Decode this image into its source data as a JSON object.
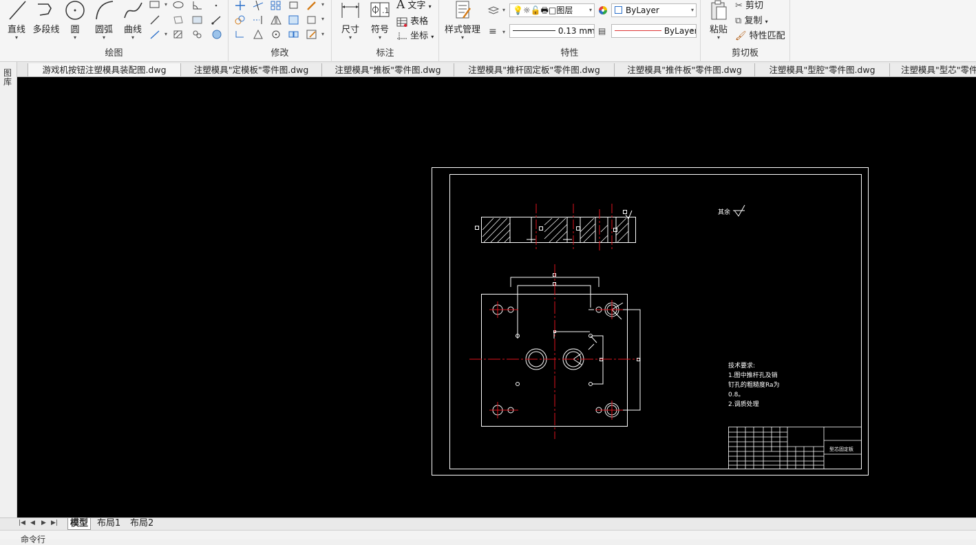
{
  "ribbon": {
    "draw": {
      "title": "绘图",
      "line": "直线",
      "polyline": "多段线",
      "circle": "圆",
      "arc": "圆弧",
      "curve": "曲线"
    },
    "modify": {
      "title": "修改"
    },
    "annotate": {
      "title": "标注",
      "dimension": "尺寸",
      "symbol": "符号",
      "text": "文字",
      "table": "表格",
      "coordinate": "坐标"
    },
    "properties": {
      "title": "特性",
      "style_manager": "样式管理",
      "layer_combo": "图层",
      "color_combo": "ByLayer",
      "lineweight_combo": "0.13 mm",
      "linetype_combo": "ByLayer"
    },
    "clipboard": {
      "title": "剪切板",
      "paste": "粘贴",
      "cut": "剪切",
      "copy": "复制",
      "match_props": "特性匹配"
    }
  },
  "file_tabs": [
    "游戏机按钮注塑模具装配图.dwg",
    "注塑模具\"定模板\"零件图.dwg",
    "注塑模具\"推板\"零件图.dwg",
    "注塑模具\"推杆固定板\"零件图.dwg",
    "注塑模具\"推件板\"零件图.dwg",
    "注塑模具\"型腔\"零件图.dwg",
    "注塑模具\"型芯\"零件图.dwg"
  ],
  "side_strip_label": "图库",
  "drawing": {
    "roughness_note": "其余",
    "tech_req": [
      "技术要求:",
      "1.图中推杆孔及销",
      "钉孔的粗糙度Ra为",
      "0.8。",
      "2.调质处理"
    ],
    "title_block_name": "型芯固定板"
  },
  "layout_tabs": [
    "模型",
    "布局1",
    "布局2"
  ],
  "command_line": "命令行",
  "colors": {
    "canvas": "#000000",
    "drawing_line": "#ffffff",
    "center_line": "#e0141e"
  }
}
